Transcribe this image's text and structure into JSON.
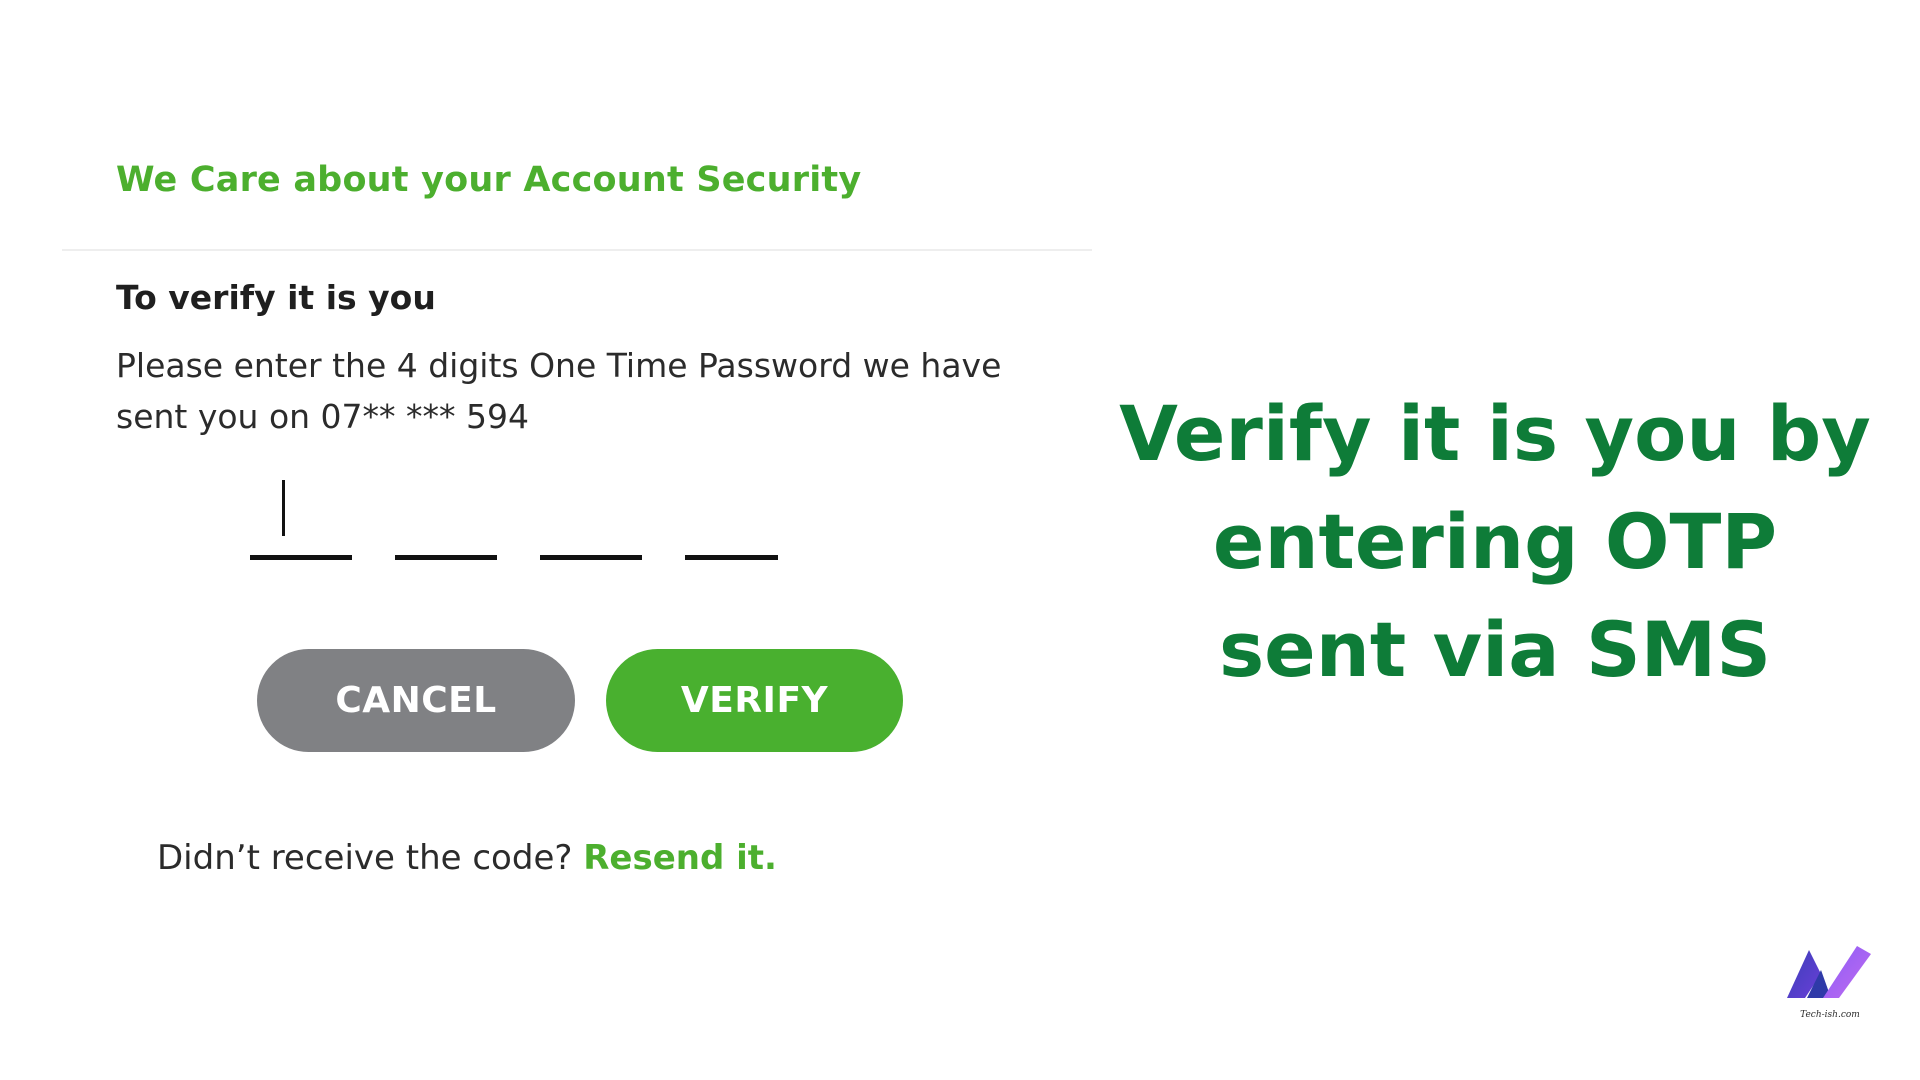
{
  "card": {
    "title": "We Care about your Account Security",
    "heading": "To verify it is you",
    "instruction": "Please enter the 4 digits One Time Password we have sent you on 07** *** 594",
    "otp": {
      "digits": [
        "",
        "",
        "",
        ""
      ],
      "focused_slot": 1
    },
    "buttons": {
      "cancel_label": "CANCEL",
      "verify_label": "VERIFY"
    },
    "resend": {
      "prompt": "Didn’t receive the code?",
      "link_label": "Resend it."
    }
  },
  "headline": "Verify it is you by entering OTP sent via SMS",
  "logo": {
    "caption": "Tech-ish.com"
  },
  "colors": {
    "accent_green": "#4caf2e",
    "headline_green": "#0e7c38",
    "cancel_gray": "#808184",
    "verify_green": "#49b02f"
  }
}
